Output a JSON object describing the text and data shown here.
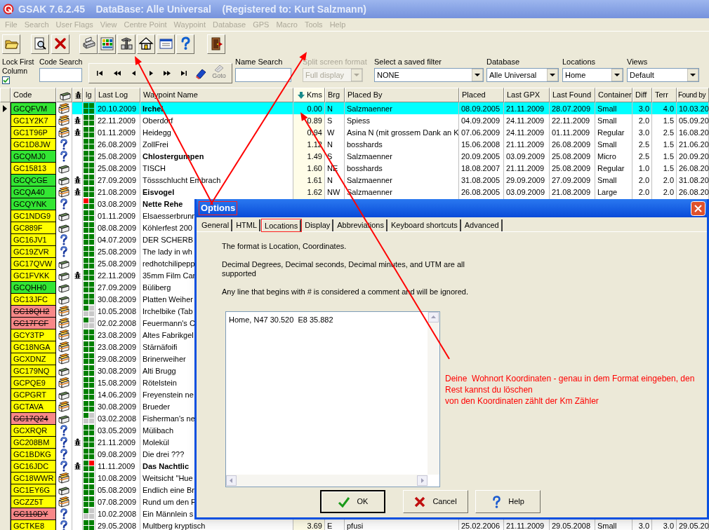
{
  "window": {
    "title": "GSAK 7.6.2.45    DataBase: Alle Universal    (Registered to: Kurt Salzmann)"
  },
  "menu": {
    "disabled": true,
    "items": [
      "File",
      "Search",
      "User Flags",
      "View",
      "Centre Point",
      "Waypoint",
      "Database",
      "GPS",
      "Macro",
      "Tools",
      "Help"
    ]
  },
  "lock_first_column": {
    "label": "Lock First Column",
    "checked": true
  },
  "code_search": {
    "label": "Code Search"
  },
  "navigator": {
    "goto_label": "Goto"
  },
  "name_search": {
    "label": "Name Search"
  },
  "dropdowns": [
    {
      "label": "Split screen format",
      "value": "Full display",
      "disabled": true
    },
    {
      "label": "Select a saved filter",
      "value": "NONE",
      "disabled": false
    },
    {
      "label": "Database",
      "value": "Alle Universal",
      "disabled": false
    },
    {
      "label": "Locations",
      "value": "Home",
      "disabled": false
    },
    {
      "label": "Views",
      "value": "Default",
      "disabled": false
    }
  ],
  "table": {
    "columns": [
      {
        "label": "Code",
        "kind": "text",
        "sorted": false
      },
      {
        "kind": "cache-icon",
        "sorted": false
      },
      {
        "kind": "bug-icon",
        "sorted": false
      },
      {
        "label": "lg",
        "kind": "text",
        "sorted": false
      },
      {
        "label": "Last Log",
        "kind": "text",
        "sorted": false
      },
      {
        "label": "Waypoint Name",
        "kind": "text",
        "sorted": false
      },
      {
        "label": "Kms",
        "kind": "text",
        "sorted": true
      },
      {
        "label": "Brg",
        "kind": "text",
        "sorted": false
      },
      {
        "label": "Placed By",
        "kind": "text",
        "sorted": false
      },
      {
        "label": "Placed",
        "kind": "text",
        "sorted": false
      },
      {
        "label": "Last GPX",
        "kind": "text",
        "sorted": false
      },
      {
        "label": "Last Found",
        "kind": "text",
        "sorted": false
      },
      {
        "label": "Container",
        "kind": "text",
        "sorted": false
      },
      {
        "label": "Diff",
        "kind": "text",
        "sorted": false
      },
      {
        "label": "Terr",
        "kind": "text",
        "sorted": false
      },
      {
        "label": "Found by",
        "kind": "text",
        "sorted": false
      }
    ],
    "rows": [
      {
        "code": "GCQFVM",
        "color": "#33e633",
        "archived": false,
        "kind": "multi",
        "bug": false,
        "dnf_first": false,
        "dnf_second": false,
        "last_log": "20.10.2009",
        "name": "Irchel",
        "bold": true,
        "selected": true,
        "cells": [
          "0.00",
          "N",
          "Salzmaenner",
          "08.09.2005",
          "21.11.2009",
          "28.07.2009",
          "Small",
          "3.0",
          "4.0",
          "10.03.20"
        ]
      },
      {
        "code": "GC1Y2K7",
        "color": "#ffff00",
        "archived": false,
        "kind": "multi",
        "bug": true,
        "dnf_first": false,
        "dnf_second": false,
        "last_log": "22.11.2009",
        "name": "Oberdorf",
        "bold": false,
        "selected": false,
        "cells": [
          "0.89",
          "S",
          "Spiess",
          "04.09.2009",
          "24.11.2009",
          "22.11.2009",
          "Small",
          "2.0",
          "1.5",
          "05.09.20"
        ]
      },
      {
        "code": "GC1T96P",
        "color": "#ffff00",
        "archived": false,
        "kind": "multi",
        "bug": true,
        "dnf_first": false,
        "dnf_second": false,
        "last_log": "01.11.2009",
        "name": "Heidegg",
        "bold": false,
        "selected": false,
        "cells": [
          "0.94",
          "W",
          "Asina N (mit grossem Dank an K",
          "07.06.2009",
          "24.11.2009",
          "01.11.2009",
          "Regular",
          "3.0",
          "2.5",
          "16.08.20"
        ]
      },
      {
        "code": "GC1D8JW",
        "color": "#ffff00",
        "archived": false,
        "kind": "mystery",
        "bug": false,
        "dnf_first": false,
        "dnf_second": false,
        "last_log": "26.08.2009",
        "name": "ZollFrei",
        "bold": false,
        "selected": false,
        "cells": [
          "1.12",
          "N",
          "bosshards",
          "15.06.2008",
          "21.11.2009",
          "26.08.2009",
          "Small",
          "2.5",
          "1.5",
          "21.06.20"
        ]
      },
      {
        "code": "GCQMJ0",
        "color": "#33e633",
        "archived": false,
        "kind": "mystery",
        "bug": false,
        "dnf_first": false,
        "dnf_second": false,
        "last_log": "25.08.2009",
        "name": "Chlostergumpen",
        "bold": true,
        "selected": false,
        "cells": [
          "1.49",
          "S",
          "Salzmaenner",
          "20.09.2005",
          "03.09.2009",
          "25.08.2009",
          "Micro",
          "2.5",
          "1.5",
          "20.09.20"
        ]
      },
      {
        "code": "GC15813",
        "color": "#ffff00",
        "archived": false,
        "kind": "traditional",
        "bug": false,
        "dnf_first": false,
        "dnf_second": false,
        "last_log": "25.08.2009",
        "name": "TISCH",
        "bold": false,
        "selected": false,
        "cells": [
          "1.60",
          "NE",
          "bosshards",
          "18.08.2007",
          "21.11.2009",
          "25.08.2009",
          "Regular",
          "1.0",
          "1.5",
          "26.08.20"
        ]
      },
      {
        "code": "GCQCGE",
        "color": "#33e633",
        "archived": false,
        "kind": "traditional",
        "bug": true,
        "dnf_first": false,
        "dnf_second": false,
        "last_log": "27.09.2009",
        "name": "Tössschlucht Embrach",
        "bold": false,
        "selected": false,
        "cells": [
          "1.61",
          "N",
          "Salzmaenner",
          "31.08.2005",
          "29.09.2009",
          "27.09.2009",
          "Small",
          "2.0",
          "2.0",
          "31.08.20"
        ]
      },
      {
        "code": "GCQA40",
        "color": "#33e633",
        "archived": false,
        "kind": "multi",
        "bug": true,
        "dnf_first": false,
        "dnf_second": false,
        "last_log": "21.08.2009",
        "name": "Eisvogel",
        "bold": true,
        "selected": false,
        "cells": [
          "1.62",
          "NW",
          "Salzmaenner",
          "26.08.2005",
          "03.09.2009",
          "21.08.2009",
          "Large",
          "2.0",
          "2.0",
          "26.08.20"
        ]
      },
      {
        "code": "GCQYNK",
        "color": "#33e633",
        "archived": false,
        "kind": "mystery",
        "bug": false,
        "dnf_first": true,
        "dnf_second": false,
        "last_log": "03.08.2009",
        "name": "Nette Rehe",
        "bold": true,
        "selected": false
      },
      {
        "code": "GC1NDG9",
        "color": "#ffff00",
        "archived": false,
        "kind": "traditional",
        "bug": false,
        "dnf_first": false,
        "dnf_second": false,
        "last_log": "01.11.2009",
        "name": "Elsaesserbrunn",
        "bold": false,
        "selected": false
      },
      {
        "code": "GC889F",
        "color": "#ffff00",
        "archived": false,
        "kind": "traditional",
        "bug": false,
        "dnf_first": false,
        "dnf_second": false,
        "last_log": "08.08.2009",
        "name": "Köhlerfest 200",
        "bold": false,
        "selected": false
      },
      {
        "code": "GC16JV1",
        "color": "#ffff00",
        "archived": false,
        "kind": "mystery",
        "bug": false,
        "dnf_first": false,
        "dnf_second": false,
        "last_log": "04.07.2009",
        "name": "DER SCHERB",
        "bold": false,
        "selected": false
      },
      {
        "code": "GC19ZVR",
        "color": "#ffff00",
        "archived": false,
        "kind": "mystery",
        "bug": false,
        "dnf_first": false,
        "dnf_second": false,
        "last_log": "25.08.2009",
        "name": "The lady in wh",
        "bold": false,
        "selected": false
      },
      {
        "code": "GC17QVW",
        "color": "#ffff00",
        "archived": false,
        "kind": "traditional",
        "bug": false,
        "dnf_first": false,
        "dnf_second": false,
        "last_log": "25.08.2009",
        "name": "redhotchilipepp",
        "bold": false,
        "selected": false
      },
      {
        "code": "GC1FVKK",
        "color": "#ffff00",
        "archived": false,
        "kind": "traditional",
        "bug": true,
        "dnf_first": false,
        "dnf_second": false,
        "last_log": "22.11.2009",
        "name": "35mm Film Car",
        "bold": false,
        "selected": false
      },
      {
        "code": "GCQHH0",
        "color": "#33e633",
        "archived": false,
        "kind": "traditional",
        "bug": false,
        "dnf_first": false,
        "dnf_second": false,
        "last_log": "27.09.2009",
        "name": "Büliberg",
        "bold": false,
        "selected": false
      },
      {
        "code": "GC13JFC",
        "color": "#ffff00",
        "archived": false,
        "kind": "traditional",
        "bug": false,
        "dnf_first": false,
        "dnf_second": false,
        "last_log": "30.08.2009",
        "name": "Platten Weiher",
        "bold": false,
        "selected": false
      },
      {
        "code": "GC18QH2",
        "color": "#f88888",
        "archived": true,
        "kind": "multi",
        "bug": false,
        "dnf_first": false,
        "dnf_second": false,
        "last_log": "10.05.2008",
        "name": "Irchelbike (Tab",
        "bold": false,
        "selected": false
      },
      {
        "code": "GC17FCF",
        "color": "#f88888",
        "archived": true,
        "kind": "multi",
        "bug": false,
        "dnf_first": false,
        "dnf_second": false,
        "last_log": "02.02.2008",
        "name": "Feuermann's C",
        "bold": false,
        "selected": false
      },
      {
        "code": "GCY3TP",
        "color": "#ffff00",
        "archived": false,
        "kind": "multi",
        "bug": false,
        "dnf_first": false,
        "dnf_second": false,
        "last_log": "23.08.2009",
        "name": "Altes Fabrikgel",
        "bold": false,
        "selected": false
      },
      {
        "code": "GC18NGA",
        "color": "#ffff00",
        "archived": false,
        "kind": "multi",
        "bug": false,
        "dnf_first": false,
        "dnf_second": false,
        "last_log": "23.08.2009",
        "name": "Stärnäfoifi",
        "bold": false,
        "selected": false
      },
      {
        "code": "GCXDNZ",
        "color": "#ffff00",
        "archived": false,
        "kind": "multi",
        "bug": false,
        "dnf_first": false,
        "dnf_second": false,
        "last_log": "29.08.2009",
        "name": "Brinerweiher",
        "bold": false,
        "selected": false
      },
      {
        "code": "GC179NQ",
        "color": "#ffff00",
        "archived": false,
        "kind": "traditional",
        "bug": false,
        "dnf_first": false,
        "dnf_second": false,
        "last_log": "30.08.2009",
        "name": "Alti Brugg",
        "bold": false,
        "selected": false
      },
      {
        "code": "GCPQE9",
        "color": "#ffff00",
        "archived": false,
        "kind": "multi",
        "bug": false,
        "dnf_first": false,
        "dnf_second": false,
        "last_log": "15.08.2009",
        "name": "Rötelstein",
        "bold": false,
        "selected": false
      },
      {
        "code": "GCPGRT",
        "color": "#ffff00",
        "archived": false,
        "kind": "traditional",
        "bug": false,
        "dnf_first": false,
        "dnf_second": false,
        "last_log": "14.06.2009",
        "name": "Freyenstein ne",
        "bold": false,
        "selected": false
      },
      {
        "code": "GCTAVA",
        "color": "#ffff00",
        "archived": false,
        "kind": "multi",
        "bug": false,
        "dnf_first": false,
        "dnf_second": false,
        "last_log": "30.08.2009",
        "name": "Brueder",
        "bold": false,
        "selected": false
      },
      {
        "code": "GC17Q24",
        "color": "#f88888",
        "archived": true,
        "kind": "traditional",
        "bug": false,
        "dnf_first": false,
        "dnf_second": false,
        "last_log": "03.02.2008",
        "name": "Fisherman's ne",
        "bold": false,
        "selected": false
      },
      {
        "code": "GCXRQR",
        "color": "#ffff00",
        "archived": false,
        "kind": "mystery",
        "bug": false,
        "dnf_first": false,
        "dnf_second": false,
        "last_log": "03.05.2009",
        "name": "Mülibach",
        "bold": false,
        "selected": false
      },
      {
        "code": "GC208BM",
        "color": "#ffff00",
        "archived": false,
        "kind": "mystery",
        "bug": true,
        "dnf_first": false,
        "dnf_second": false,
        "last_log": "21.11.2009",
        "name": "Molekül",
        "bold": false,
        "selected": false
      },
      {
        "code": "GC1BDKG",
        "color": "#ffff00",
        "archived": false,
        "kind": "mystery",
        "bug": false,
        "dnf_first": false,
        "dnf_second": false,
        "last_log": "09.08.2009",
        "name": "Die drei ???",
        "bold": false,
        "selected": false
      },
      {
        "code": "GC16JDC",
        "color": "#ffff00",
        "archived": false,
        "kind": "mystery",
        "bug": true,
        "dnf_first": false,
        "dnf_second": true,
        "last_log": "11.11.2009",
        "name": "Das Nachtlic",
        "bold": true,
        "selected": false
      },
      {
        "code": "GC18WWR",
        "color": "#ffff00",
        "archived": false,
        "kind": "multi",
        "bug": false,
        "dnf_first": false,
        "dnf_second": false,
        "last_log": "10.08.2009",
        "name": "Weitsicht \"Hue",
        "bold": false,
        "selected": false
      },
      {
        "code": "GC1EY6G",
        "color": "#ffff00",
        "archived": false,
        "kind": "traditional",
        "bug": false,
        "dnf_first": false,
        "dnf_second": false,
        "last_log": "05.08.2009",
        "name": "Endlich eine Br",
        "bold": false,
        "selected": false
      },
      {
        "code": "GCZZ5T",
        "color": "#ffff00",
        "archived": false,
        "kind": "multi",
        "bug": false,
        "dnf_first": false,
        "dnf_second": false,
        "last_log": "07.08.2009",
        "name": "Rund um den F",
        "bold": false,
        "selected": false
      },
      {
        "code": "GC110DY",
        "color": "#f88888",
        "archived": true,
        "kind": "mystery",
        "bug": false,
        "dnf_first": false,
        "dnf_second": false,
        "last_log": "10.02.2008",
        "name": "Ein Männlein s",
        "bold": false,
        "selected": false
      },
      {
        "code": "GCTKE8",
        "color": "#ffff00",
        "archived": false,
        "kind": "mystery",
        "bug": false,
        "dnf_first": false,
        "dnf_second": false,
        "last_log": "29.05.2008",
        "name": "Multberg kryptisch",
        "bold": false,
        "selected": false,
        "cells": [
          "3.69",
          "E",
          "pfusi",
          "25.02.2006",
          "21.11.2009",
          "29.05.2008",
          "Small",
          "3.0",
          "3.0",
          "29.05.20"
        ]
      }
    ]
  },
  "dialog": {
    "title": "Options",
    "title_highlighted": true,
    "tabs": [
      {
        "label": "General",
        "selected": false,
        "highlighted": false
      },
      {
        "label": "HTML",
        "selected": false,
        "highlighted": false
      },
      {
        "label": "Locations",
        "selected": true,
        "highlighted": true
      },
      {
        "label": "Display",
        "selected": false,
        "highlighted": false
      },
      {
        "label": "Abbreviations",
        "selected": false,
        "highlighted": false
      },
      {
        "label": "Keyboard shortcuts",
        "selected": false,
        "highlighted": false
      },
      {
        "label": "Advanced",
        "selected": false,
        "highlighted": false
      }
    ],
    "paragraphs": [
      "The format is Location, Coordinates.",
      "Decimal Degrees, Decimal seconds, Decimal minutes, and UTM are all supported",
      "Any line that begins with # is considered a comment and will be ignored."
    ],
    "locations_text": "Home, N47 30.520  E8 35.882",
    "buttons": [
      {
        "label": "OK",
        "default": true
      },
      {
        "label": "Cancel",
        "default": false
      },
      {
        "label": "Help",
        "default": false
      }
    ]
  },
  "annotation": {
    "note_lines": [
      "Deine  Wohnort Koordinaten - genau in dem Format eingeben, den Rest kannst du löschen",
      "von den Koordinaten zählt der Km Zähler"
    ]
  }
}
